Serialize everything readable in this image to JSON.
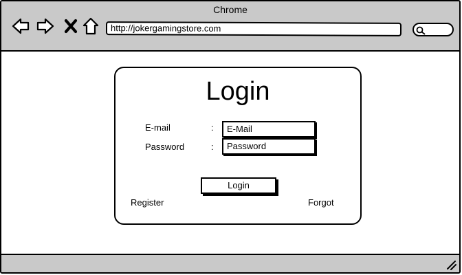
{
  "window": {
    "title": "Chrome"
  },
  "toolbar": {
    "url": "http://jokergamingstore.com"
  },
  "login": {
    "title": "Login",
    "email_label": "E-mail",
    "password_label": "Password",
    "colon": ":",
    "email_value": "E-Mail",
    "password_value": "Password",
    "submit_label": "Login",
    "register_link": "Register",
    "forgot_link": "Forgot"
  },
  "icons": {
    "back": "arrow-left-icon",
    "forward": "arrow-right-icon",
    "stop": "close-icon",
    "home": "home-icon",
    "search": "search-icon",
    "resize": "resize-grip-icon"
  },
  "colors": {
    "chrome": "#c9c9c9",
    "border": "#000000",
    "background": "#ffffff"
  }
}
